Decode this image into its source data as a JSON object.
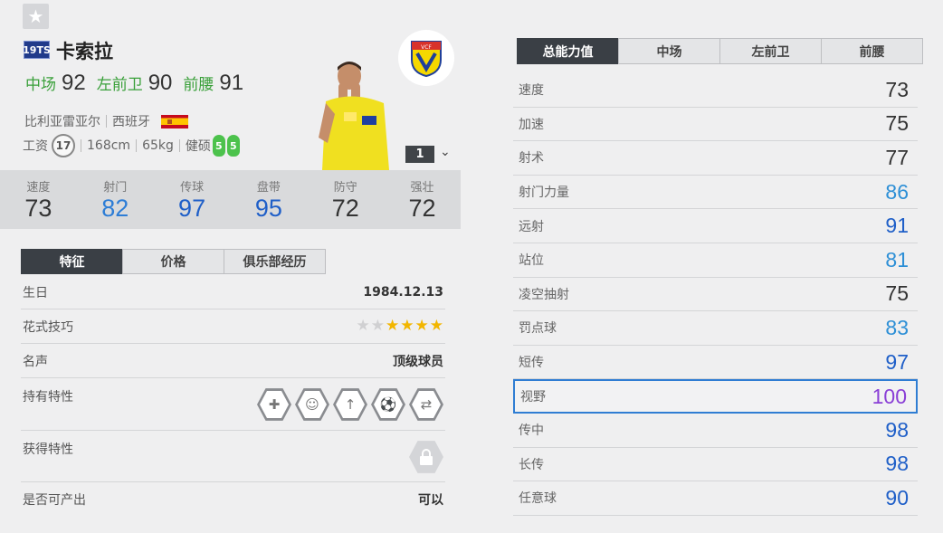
{
  "player": {
    "season_badge": "19TS",
    "name": "卡索拉",
    "positions": [
      {
        "name": "中场",
        "value": "92"
      },
      {
        "name": "左前卫",
        "value": "90"
      },
      {
        "name": "前腰",
        "value": "91"
      }
    ],
    "club": "比利亚雷亚尔",
    "nation": "西班牙",
    "wage_label": "工资",
    "wage": "17",
    "height": "168cm",
    "weight": "65kg",
    "body_type": "健硕",
    "left_foot": "5",
    "right_foot": "5",
    "level": "1"
  },
  "summary_stats": [
    {
      "label": "速度",
      "value": "73"
    },
    {
      "label": "射门",
      "value": "82"
    },
    {
      "label": "传球",
      "value": "97"
    },
    {
      "label": "盘带",
      "value": "95"
    },
    {
      "label": "防守",
      "value": "72"
    },
    {
      "label": "强壮",
      "value": "72"
    }
  ],
  "left_tabs": [
    "特征",
    "价格",
    "俱乐部经历"
  ],
  "details": {
    "birth_label": "生日",
    "birth": "1984.12.13",
    "skill_label": "花式技巧",
    "skill_stars": 4,
    "skill_max": 6,
    "fame_label": "名声",
    "fame": "顶级球员",
    "traits_label": "持有特性",
    "traits_icons": [
      "injury-resistant-icon",
      "playmaker-icon",
      "long-shot-icon",
      "set-piece-icon",
      "dribble-icon"
    ],
    "earned_label": "获得特性",
    "produce_label": "是否可产出",
    "produce": "可以"
  },
  "right_tabs": [
    "总能力值",
    "中场",
    "左前卫",
    "前腰"
  ],
  "attributes": [
    {
      "name": "速度",
      "value": "73",
      "color": "dark"
    },
    {
      "name": "加速",
      "value": "75",
      "color": "dark"
    },
    {
      "name": "射术",
      "value": "77",
      "color": "dark"
    },
    {
      "name": "射门力量",
      "value": "86",
      "color": "blue"
    },
    {
      "name": "远射",
      "value": "91",
      "color": "dblue"
    },
    {
      "name": "站位",
      "value": "81",
      "color": "blue"
    },
    {
      "name": "凌空抽射",
      "value": "75",
      "color": "dark"
    },
    {
      "name": "罚点球",
      "value": "83",
      "color": "blue"
    },
    {
      "name": "短传",
      "value": "97",
      "color": "dblue"
    },
    {
      "name": "视野",
      "value": "100",
      "color": "purple"
    },
    {
      "name": "传中",
      "value": "98",
      "color": "dblue"
    },
    {
      "name": "长传",
      "value": "98",
      "color": "dblue"
    },
    {
      "name": "任意球",
      "value": "90",
      "color": "dblue"
    }
  ],
  "highlight_attribute": "视野"
}
